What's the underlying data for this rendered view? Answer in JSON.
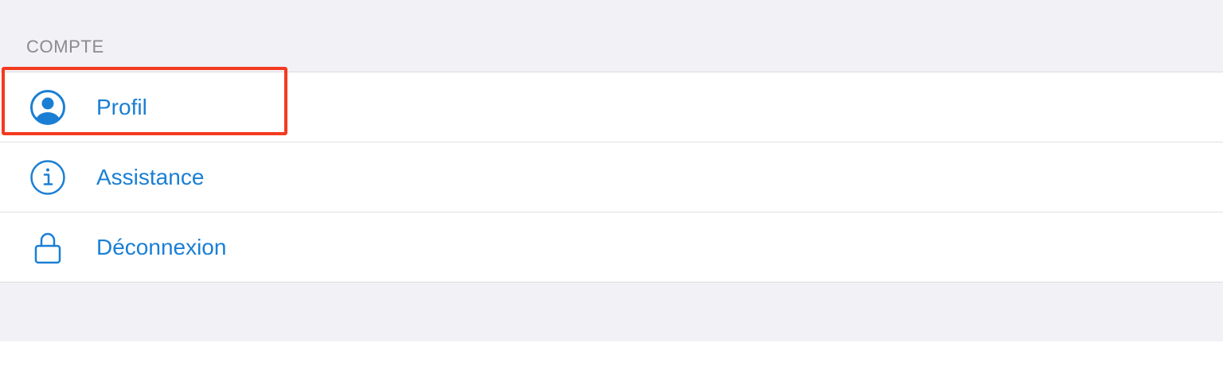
{
  "section": {
    "header": "COMPTE"
  },
  "items": [
    {
      "label": "Profil",
      "icon": "person-circle-icon"
    },
    {
      "label": "Assistance",
      "icon": "info-circle-icon"
    },
    {
      "label": "Déconnexion",
      "icon": "lock-icon"
    }
  ],
  "highlight": {
    "target": "Profil",
    "color": "#f43a1f"
  },
  "colors": {
    "accent": "#1a7fd4",
    "background": "#f1f1f6",
    "header_text": "#8a8a8f"
  }
}
